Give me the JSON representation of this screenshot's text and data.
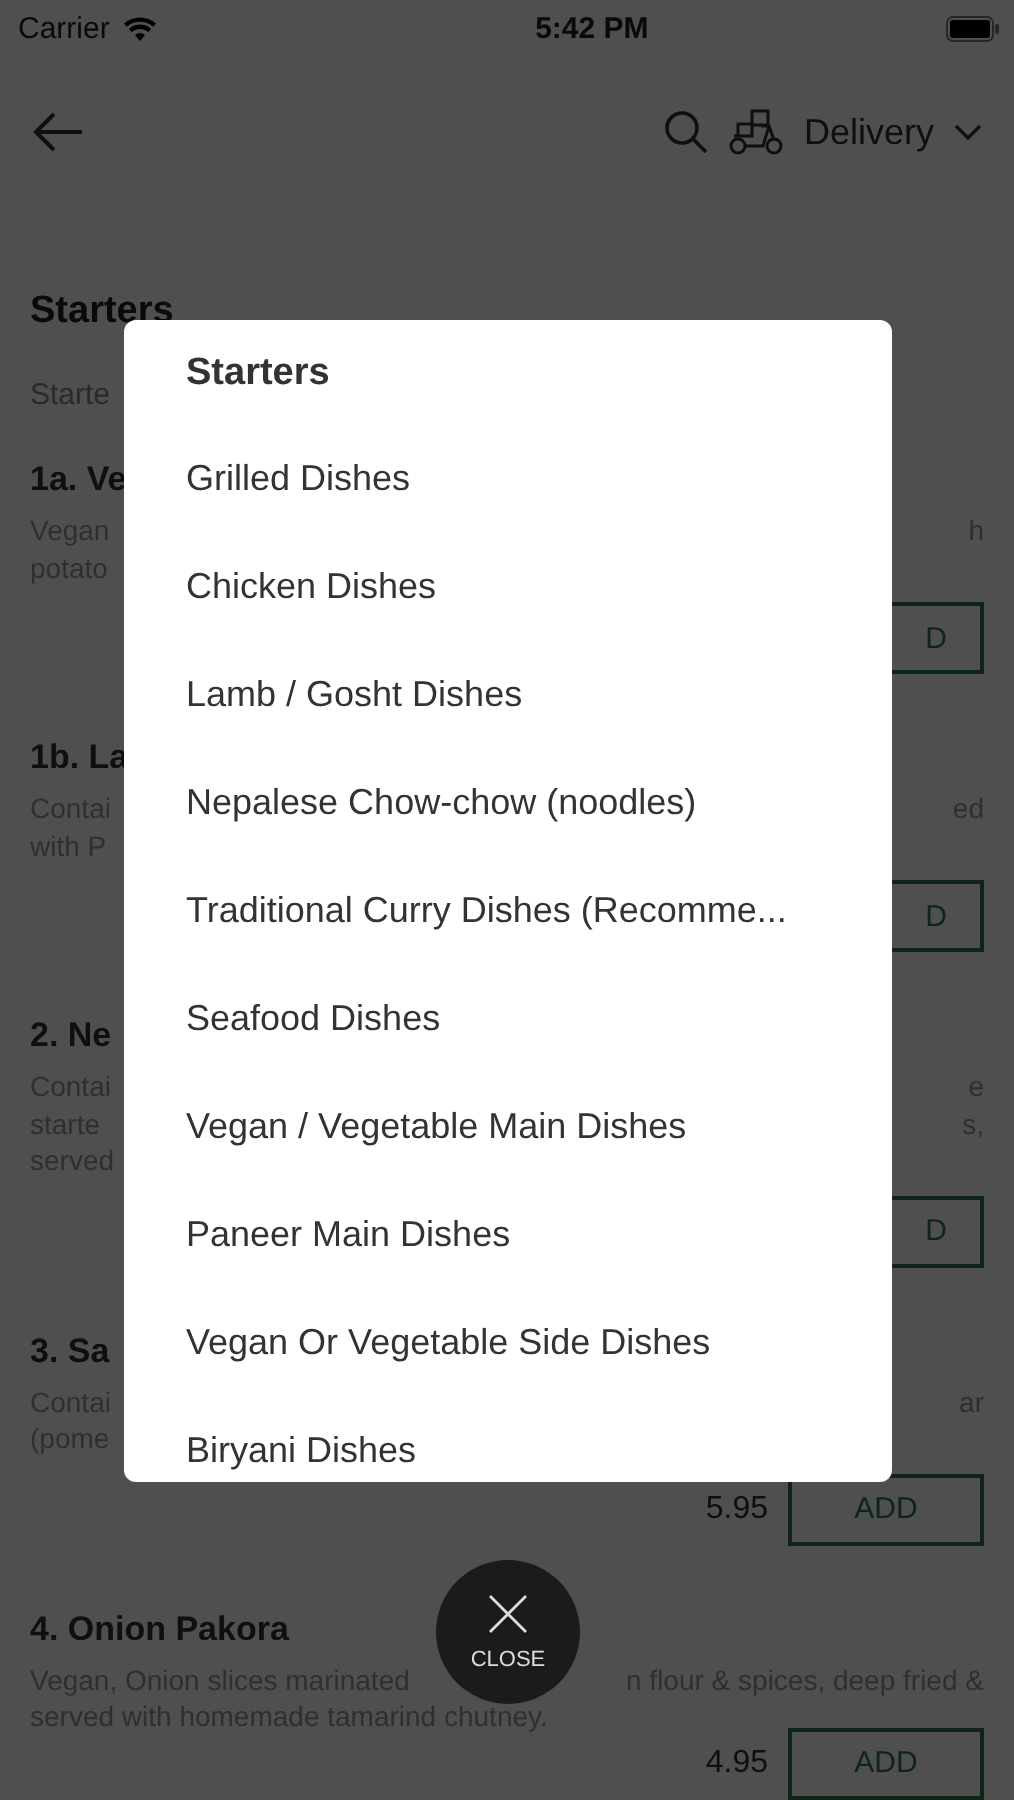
{
  "status_bar": {
    "carrier": "Carrier",
    "time": "5:42 PM"
  },
  "nav": {
    "delivery_label": "Delivery"
  },
  "menu_rows": [
    {
      "kind": "heading",
      "left": "Starters"
    },
    {
      "kind": "subheading",
      "left": "Starte"
    },
    {
      "kind": "item",
      "left": "1a. Ve"
    },
    {
      "kind": "desc",
      "left": "Vegan",
      "right": "h"
    },
    {
      "kind": "desc",
      "left": "potato"
    },
    {
      "kind": "add",
      "button": "D"
    },
    {
      "kind": "item",
      "left": "1b. La"
    },
    {
      "kind": "desc",
      "left": "Contai",
      "right": "ed"
    },
    {
      "kind": "desc",
      "left": "with P"
    },
    {
      "kind": "add",
      "button": "D"
    },
    {
      "kind": "item",
      "left": "2. Ne"
    },
    {
      "kind": "desc",
      "left": "Contai",
      "right": "e"
    },
    {
      "kind": "desc",
      "left": "starte",
      "right": "s,"
    },
    {
      "kind": "desc",
      "left": "served"
    },
    {
      "kind": "add",
      "button": "D"
    },
    {
      "kind": "item",
      "left": "3. Sa"
    },
    {
      "kind": "desc",
      "left": "Contai",
      "right": "ar"
    },
    {
      "kind": "desc",
      "left": "(pome"
    },
    {
      "kind": "add",
      "price": "5.95",
      "button": "ADD"
    },
    {
      "kind": "item",
      "left": "4. Onion Pakora"
    },
    {
      "kind": "desc",
      "left": "Vegan, Onion slices marinated",
      "right": "n flour & spices, deep fried &"
    },
    {
      "kind": "desc",
      "left": "served with homemade tamarind chutney."
    },
    {
      "kind": "add",
      "price": "4.95",
      "button": "ADD"
    }
  ],
  "category_dialog": {
    "title": "Starters",
    "items": [
      "Grilled Dishes",
      "Chicken Dishes",
      "Lamb / Gosht Dishes",
      "Nepalese Chow-chow (noodles)",
      "Traditional Curry Dishes (Recomme...",
      "Seafood Dishes",
      "Vegan / Vegetable Main Dishes",
      "Paneer Main Dishes",
      "Vegan Or Vegetable Side Dishes",
      "Biryani Dishes"
    ]
  },
  "close_button": {
    "label": "CLOSE"
  }
}
